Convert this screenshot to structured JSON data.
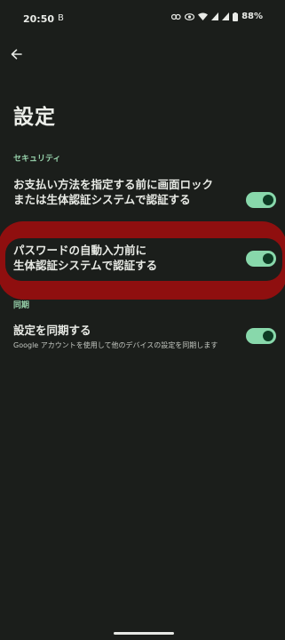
{
  "status_bar": {
    "time": "20:50",
    "indicator": "B",
    "battery": "88%",
    "icons": [
      "link-icon",
      "eye-icon",
      "wifi-icon",
      "signal-icon",
      "signal-icon",
      "battery-icon"
    ]
  },
  "header": {
    "back_icon": "arrow-left-icon",
    "title": "設定"
  },
  "sections": {
    "security": {
      "header": "セキュリティ",
      "items": [
        {
          "title": "お支払い方法を指定する前に画面ロックまたは生体認証システムで認証する",
          "enabled": true
        },
        {
          "title_line1": "パスワードの自動入力前に",
          "title_line2": "生体認証システムで認証する",
          "enabled": true
        }
      ]
    },
    "sync": {
      "header": "同期",
      "items": [
        {
          "title": "設定を同期する",
          "subtitle": "Google アカウントを使用して他のデバイスの設定を同期します",
          "enabled": true
        }
      ]
    }
  },
  "colors": {
    "background": "#1b1e1b",
    "accent": "#88d8ab",
    "section_header": "#98d3ac",
    "highlight": "#8f0f0f"
  }
}
